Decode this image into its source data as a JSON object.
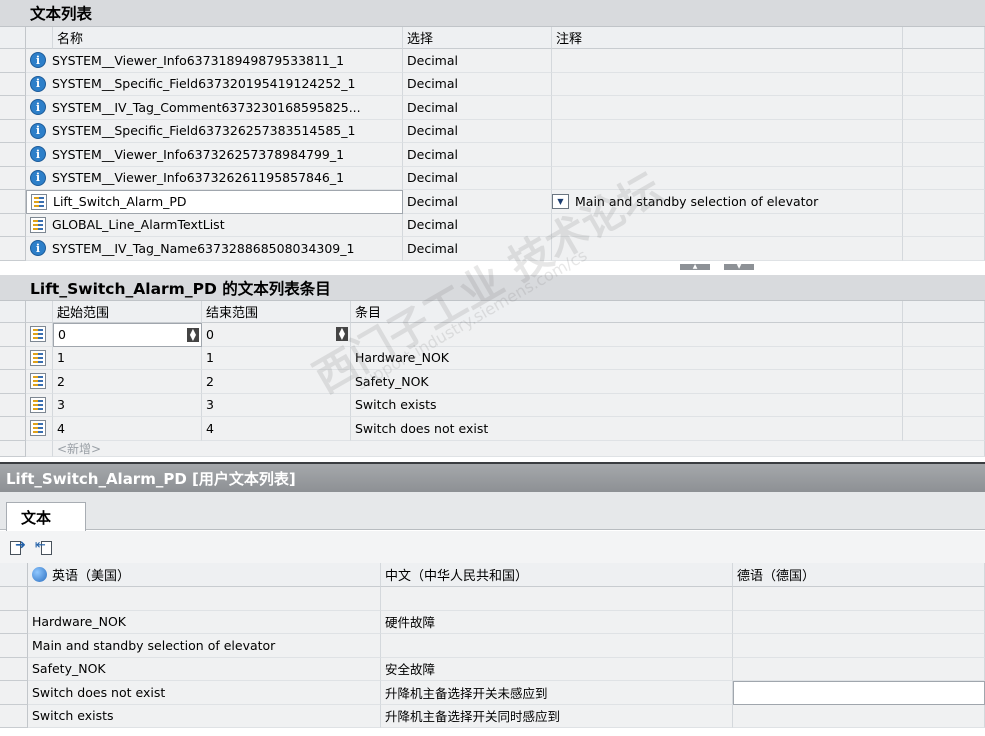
{
  "textlist_section": {
    "title": "文本列表",
    "columns": [
      "名称",
      "选择",
      "注释"
    ],
    "rows": [
      {
        "icon": "info-icon",
        "name": "SYSTEM__Viewer_Info637318949879533811_1",
        "selection": "Decimal",
        "comment": ""
      },
      {
        "icon": "info-icon",
        "name": "SYSTEM__Specific_Field637320195419124252_1",
        "selection": "Decimal",
        "comment": ""
      },
      {
        "icon": "info-icon",
        "name": "SYSTEM__IV_Tag_Comment6373230168595825...",
        "selection": "Decimal",
        "comment": ""
      },
      {
        "icon": "info-icon",
        "name": "SYSTEM__Specific_Field637326257383514585_1",
        "selection": "Decimal",
        "comment": ""
      },
      {
        "icon": "info-icon",
        "name": "SYSTEM__Viewer_Info637326257378984799_1",
        "selection": "Decimal",
        "comment": ""
      },
      {
        "icon": "info-icon",
        "name": "SYSTEM__Viewer_Info637326261195857846_1",
        "selection": "Decimal",
        "comment": ""
      },
      {
        "icon": "list-icon",
        "name": "Lift_Switch_Alarm_PD",
        "selection": "Decimal",
        "comment": "Main and standby selection of elevator"
      },
      {
        "icon": "list-icon",
        "name": "GLOBAL_Line_AlarmTextList",
        "selection": "Decimal",
        "comment": ""
      },
      {
        "icon": "info-icon",
        "name": "SYSTEM__IV_Tag_Name637328868508034309_1",
        "selection": "Decimal",
        "comment": ""
      }
    ]
  },
  "entries_section": {
    "title": "Lift_Switch_Alarm_PD 的文本列表条目",
    "columns": [
      "起始范围",
      "结束范围",
      "条目"
    ],
    "rows": [
      {
        "start": "0",
        "end": "0",
        "entry": ""
      },
      {
        "start": "1",
        "end": "1",
        "entry": "Hardware_NOK"
      },
      {
        "start": "2",
        "end": "2",
        "entry": "Safety_NOK"
      },
      {
        "start": "3",
        "end": "3",
        "entry": "Switch exists"
      },
      {
        "start": "4",
        "end": "4",
        "entry": "Switch does not exist"
      }
    ],
    "new_row_label": "<新增>"
  },
  "properties_panel": {
    "title": "Lift_Switch_Alarm_PD [用户文本列表]",
    "tab": "文本"
  },
  "translations": {
    "columns": [
      "英语（美国）",
      "中文（中华人民共和国）",
      "德语（德国）"
    ],
    "rows": [
      {
        "en": "",
        "zh": "",
        "de": ""
      },
      {
        "en": "Hardware_NOK",
        "zh": "硬件故障",
        "de": ""
      },
      {
        "en": "Main and standby selection of elevator",
        "zh": "",
        "de": ""
      },
      {
        "en": "Safety_NOK",
        "zh": "安全故障",
        "de": ""
      },
      {
        "en": "Switch does not exist",
        "zh": "升降机主备选择开关未感应到",
        "de": ""
      },
      {
        "en": "Switch exists",
        "zh": "升降机主备选择开关同时感应到",
        "de": ""
      }
    ]
  },
  "watermark": {
    "line1": "西门子工业 技术论坛",
    "line2": "support.industry.siemens.com/cs"
  },
  "colors": {
    "section_header_bg": "#d8dadd",
    "splitter_bg": "#9a9da1",
    "info_icon": "#2d7fc9"
  }
}
